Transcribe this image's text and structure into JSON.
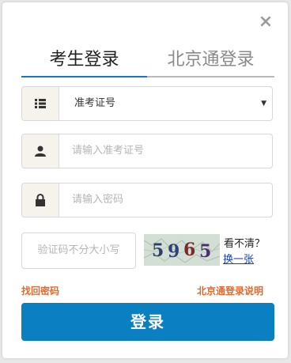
{
  "tabs": {
    "active_label": "考生登录",
    "inactive_label": "北京通登录"
  },
  "close_icon": "×",
  "id_type": {
    "selected_value": "准考证号",
    "icon": "list-icon"
  },
  "id_number": {
    "placeholder": "请输入准考证号",
    "icon": "user-icon"
  },
  "password": {
    "placeholder": "请输入密码",
    "icon": "lock-icon"
  },
  "captcha": {
    "placeholder": "验证码不分大小写",
    "image_text": "5965",
    "unclear_label": "看不清？",
    "refresh_label": "换一张"
  },
  "links": {
    "forgot_password": "找回密码",
    "beijingtong_help": "北京通登录说明"
  },
  "login_button": "登录",
  "colors": {
    "accent": "#1677c9",
    "button": "#0a7fc2",
    "link": "#e4692d"
  }
}
